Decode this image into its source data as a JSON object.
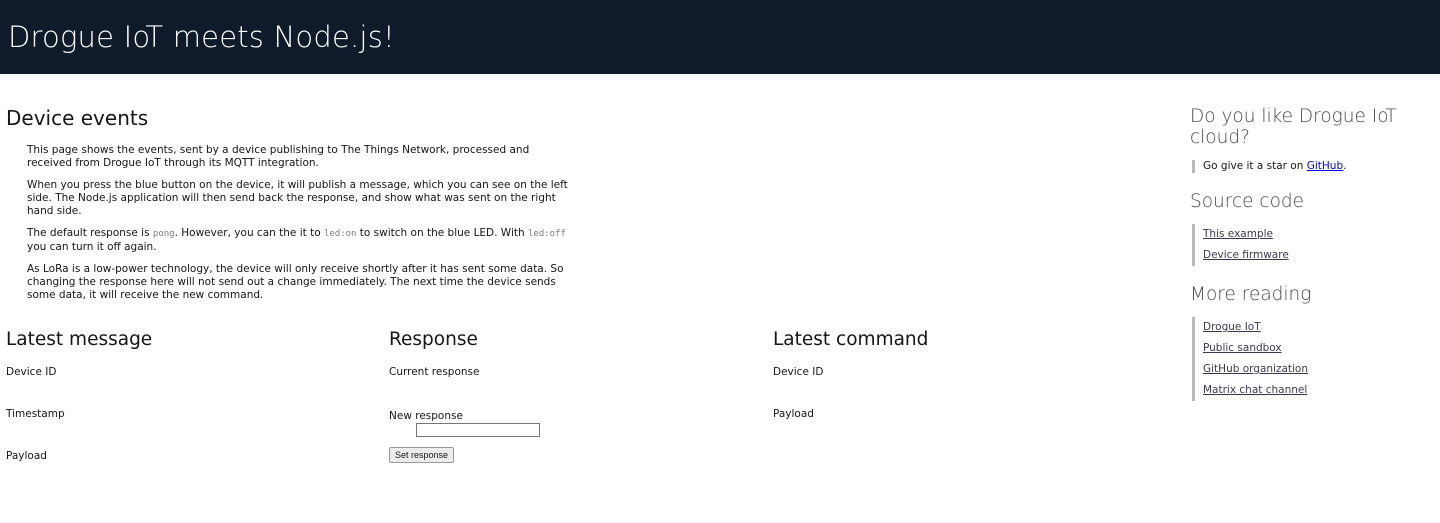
{
  "header": {
    "title": "Drogue IoT meets Node.js!"
  },
  "device_events": {
    "title": "Device events",
    "p1": "This page shows the events, sent by a device publishing to The Things Network, processed and received from Drogue IoT through its MQTT integration.",
    "p2": "When you press the blue button on the device, it will publish a message, which you can see on the left side. The Node.js application will then send back the response, and show what was sent on the right hand side.",
    "p3_a": "The default response is ",
    "p3_code1": "pong",
    "p3_b": ". However, you can the it to ",
    "p3_code2": "led:on",
    "p3_c": " to switch on the blue LED. With ",
    "p3_code3": "led:off",
    "p3_d": " you can turn it off again.",
    "p4": "As LoRa is a low-power technology, the device will only receive shortly after it has sent some data. So changing the response here will not send out a change immediately. The next time the device sends some data, it will receive the new command."
  },
  "latest_message": {
    "title": "Latest message",
    "device_id": "Device ID",
    "timestamp": "Timestamp",
    "payload": "Payload"
  },
  "response": {
    "title": "Response",
    "current": "Current response",
    "new": "New response",
    "input_value": "",
    "button": "Set response"
  },
  "latest_command": {
    "title": "Latest command",
    "device_id": "Device ID",
    "payload": "Payload"
  },
  "sidebar": {
    "like_title": "Do you like Drogue IoT cloud?",
    "like_text": "Go give it a star on ",
    "like_link": "GitHub",
    "like_end": ".",
    "source_title": "Source code",
    "source_links": [
      "This example",
      "Device firmware"
    ],
    "reading_title": "More reading",
    "reading_links": [
      "Drogue IoT",
      "Public sandbox",
      "GitHub organization",
      "Matrix chat channel"
    ]
  }
}
